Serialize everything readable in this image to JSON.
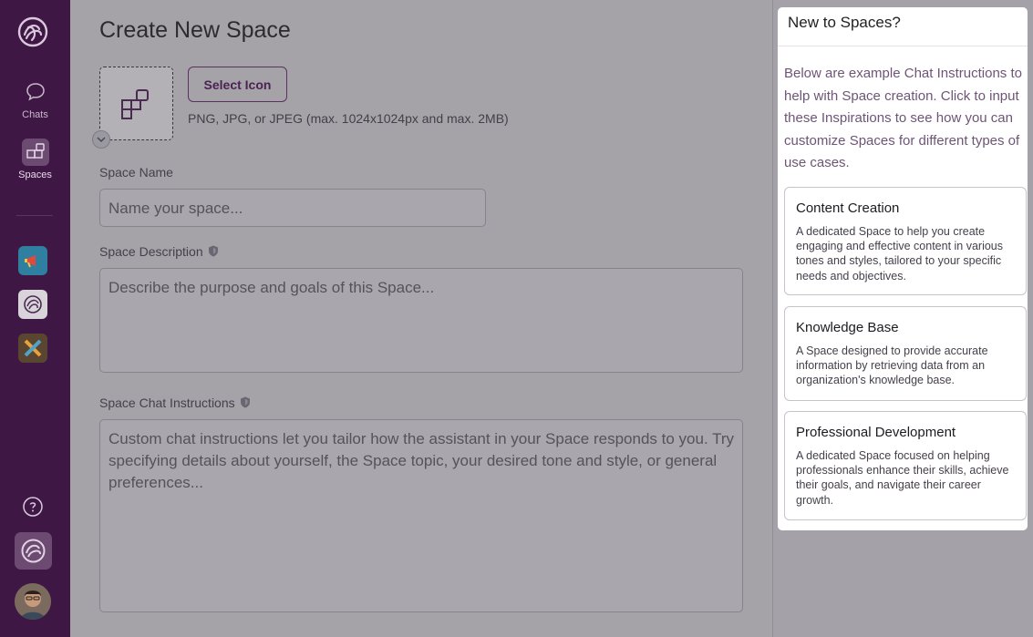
{
  "sidebar": {
    "nav": [
      {
        "label": "Chats",
        "icon": "chat-bubble-icon"
      },
      {
        "label": "Spaces",
        "icon": "spaces-grid-icon"
      }
    ],
    "apps": [
      {
        "icon": "megaphone-app-icon",
        "color": "#2f7fa0"
      },
      {
        "icon": "knot-app-icon",
        "color": "#d8d4da"
      },
      {
        "icon": "pencil-ruler-app-icon",
        "color": "#5a4630"
      }
    ],
    "accent": "#3e1744"
  },
  "main": {
    "title": "Create New Space",
    "select_icon_label": "Select Icon",
    "icon_hint": "PNG, JPG, or JPEG (max. 1024x1024px and max. 2MB)",
    "space_name": {
      "label": "Space Name",
      "placeholder": "Name your space..."
    },
    "space_description": {
      "label": "Space Description",
      "placeholder": "Describe the purpose and goals of this Space..."
    },
    "chat_instructions": {
      "label": "Space Chat Instructions",
      "placeholder": "Custom chat instructions let you tailor how the assistant in your Space responds to you. Try specifying details about yourself, the Space topic, your desired tone and style, or general preferences..."
    }
  },
  "panel": {
    "title": "New to Spaces?",
    "intro": "Below are example Chat Instructions to help with Space creation. Click to input these Inspirations to see how you can customize Spaces for different types of use cases.",
    "cards": [
      {
        "title": "Content Creation",
        "description": "A dedicated Space to help you create engaging and effective content in various tones and styles, tailored to your specific needs and objectives."
      },
      {
        "title": "Knowledge Base",
        "description": "A Space designed to provide accurate information by retrieving data from an organization's knowledge base."
      },
      {
        "title": "Professional Development",
        "description": "A dedicated Space focused on helping professionals enhance their skills, achieve their goals, and navigate their career growth."
      }
    ]
  }
}
